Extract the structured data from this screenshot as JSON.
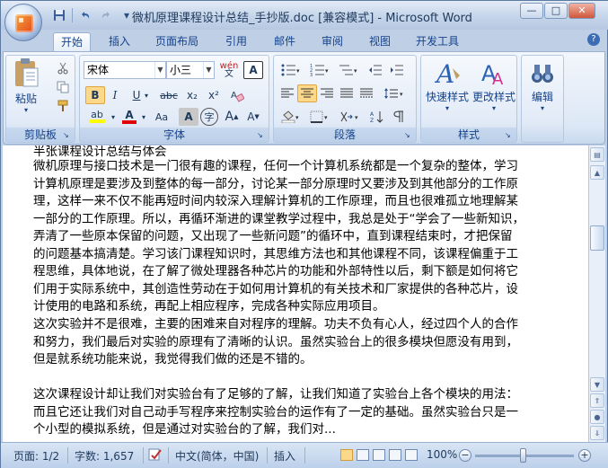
{
  "window": {
    "title": "微机原理课程设计总结_手抄版.doc [兼容模式] - Microsoft Word",
    "controls": {
      "minimize": "—",
      "maximize": "□",
      "close": "✕"
    }
  },
  "quick_access": {
    "save": "save-icon",
    "undo": "undo-icon",
    "redo": "redo-icon",
    "more": "▾"
  },
  "tabs": [
    "开始",
    "插入",
    "页面布局",
    "引用",
    "邮件",
    "审阅",
    "视图",
    "开发工具"
  ],
  "ribbon": {
    "clipboard": {
      "label": "剪贴板",
      "paste": "粘贴"
    },
    "font": {
      "label": "字体",
      "font_name": "宋体",
      "font_size": "小三",
      "wen": "wén",
      "A_box": "A",
      "bold": "B",
      "italic": "I",
      "underline": "U",
      "strike": "abc",
      "sub": "x₂",
      "sup": "x²",
      "highlight": "ab",
      "color": "A",
      "case": "Aa",
      "shade": "A",
      "enc": "字",
      "grow": "A",
      "shrink": "A"
    },
    "paragraph": {
      "label": "段落"
    },
    "styles": {
      "label": "样式",
      "quick": "快速样式",
      "change": "更改样式"
    },
    "editing": {
      "label": "编辑"
    }
  },
  "document": {
    "top_partial": "半张课程设计总结与体会",
    "paragraphs": [
      "微机原理与接口技术是一门很有趣的课程，任何一个计算机系统都是一个复杂的整体，学习\n计算机原理是要涉及到整体的每一部分，讨论某一部分原理时又要涉及到其他部分的工作原\n理，这样一来不仅不能再短时间内较深入理解计算机的工作原理，而且也很难孤立地理解某\n一部分的工作原理。所以，再循环渐进的课堂教学过程中，我总是处于“学会了一些新知识，\n弄清了一些原本保留的问题，又出现了一些新问题”的循环中，直到课程结束时，才把保留\n的问题基本搞清楚。学习该门课程知识时，其思维方法也和其他课程不同，该课程偏重于工\n程思维，具体地说，在了解了微处理器各种芯片的功能和外部特性以后，剩下额是如何将它\n们用于实际系统中，其创造性劳动在于如何用计算机的有关技术和厂家提供的各种芯片，设\n计使用的电路和系统，再配上相应程序，完成各种实际应用项目。",
      "这次实验并不是很难，主要的困难来自对程序的理解。功夫不负有心人，经过四个人的合作\n和努力，我们最后对实验的原理有了清晰的认识。虽然实验台上的很多模块但愿没有用到，\n但是就系统功能来说，我觉得我们做的还是不错的。",
      "这次课程设计却让我们对实验台有了足够的了解，让我们知道了实验台上各个模块的用法：\n而且它还让我们对自己动手写程序来控制实验台的运作有了一定的基础。虽然实验台只是一\n个小型的模拟系统，但是通过对实验台的了解，我们对..."
    ]
  },
  "status": {
    "page": "页面: 1/2",
    "words": "字数: 1,657",
    "lang": "中文(简体，中国)",
    "mode": "插入",
    "zoom": "100%",
    "zoom_value": 100
  }
}
